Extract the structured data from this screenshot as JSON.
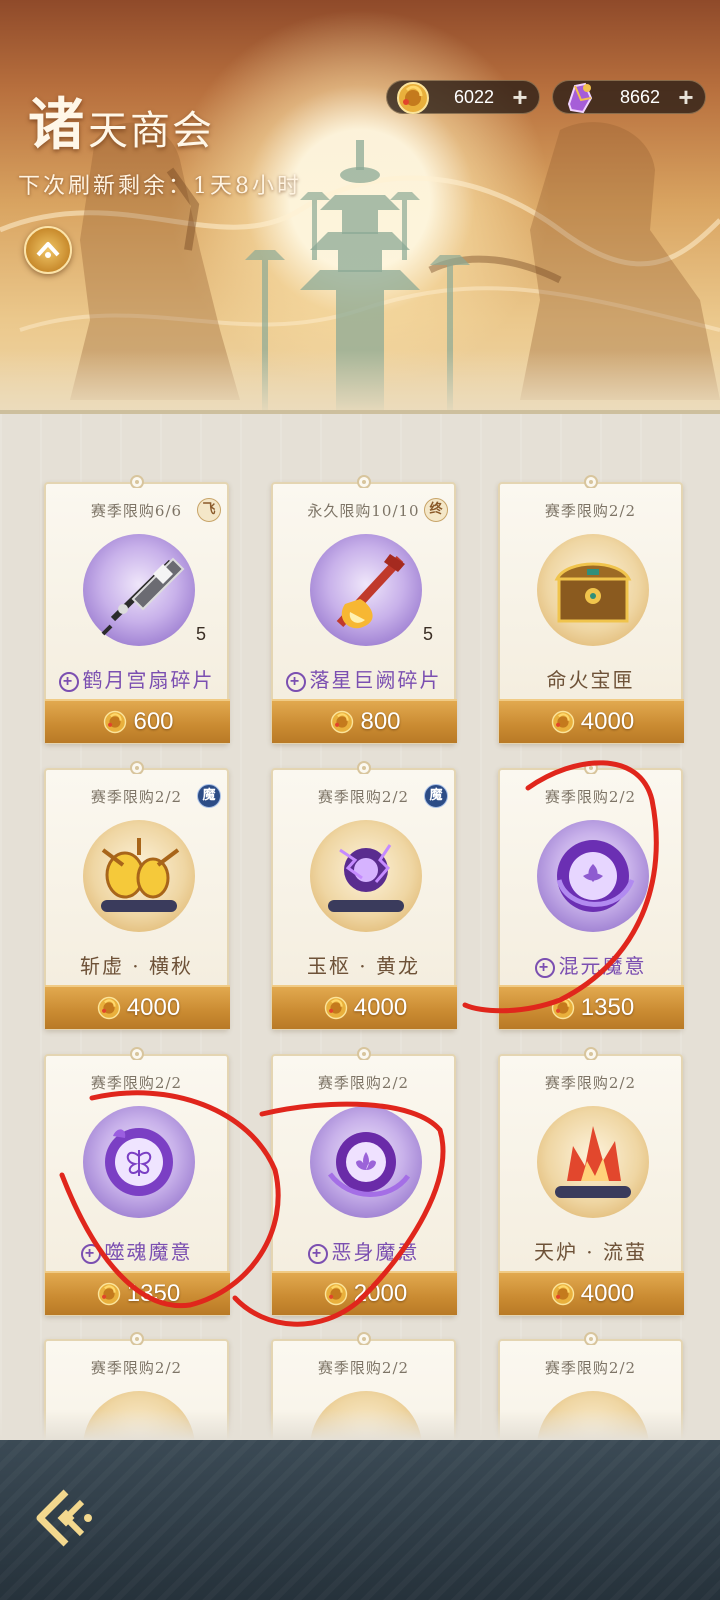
{
  "header": {
    "title_first": "诸",
    "title_rest": "天商会",
    "refresh_text": "下次刷新剩余：1天8小时"
  },
  "currencies": [
    {
      "name": "gold-coin",
      "value": "6022",
      "plus": "+"
    },
    {
      "name": "purple-crystal",
      "value": "8662",
      "plus": "+"
    }
  ],
  "items": [
    {
      "limit": "赛季限购6/6",
      "tag": "飞",
      "tag_style": "brown",
      "name": "鹤月宫扇碎片",
      "count": "5",
      "price": "600",
      "orb": "purple",
      "name_style": "purple",
      "plus": true,
      "icon": "fan-icon"
    },
    {
      "limit": "永久限购10/10",
      "tag": "终",
      "tag_style": "brown",
      "name": "落星巨阙碎片",
      "count": "5",
      "price": "800",
      "orb": "purple",
      "name_style": "purple",
      "plus": true,
      "icon": "sword-icon"
    },
    {
      "limit": "赛季限购2/2",
      "tag": "",
      "tag_style": "",
      "name": "命火宝匣",
      "count": "",
      "price": "4000",
      "orb": "gold",
      "name_style": "brown",
      "plus": false,
      "icon": "treasure-chest-icon"
    },
    {
      "limit": "赛季限购2/2",
      "tag": "魔",
      "tag_style": "blue",
      "name": "斩虚 · 横秋",
      "count": "",
      "price": "4000",
      "orb": "gold",
      "name_style": "brown",
      "plus": false,
      "icon": "golden-orbs-scroll-icon"
    },
    {
      "limit": "赛季限购2/2",
      "tag": "魔",
      "tag_style": "blue",
      "name": "玉枢 · 黄龙",
      "count": "",
      "price": "4000",
      "orb": "gold",
      "name_style": "brown",
      "plus": false,
      "icon": "lightning-scroll-icon"
    },
    {
      "limit": "赛季限购2/2",
      "tag": "",
      "tag_style": "",
      "name": "混元魔意",
      "count": "",
      "price": "1350",
      "orb": "purple",
      "name_style": "purple",
      "plus": true,
      "icon": "purple-flower-orb-icon"
    },
    {
      "limit": "赛季限购2/2",
      "tag": "",
      "tag_style": "",
      "name": "噬魂魔意",
      "count": "",
      "price": "1350",
      "orb": "purple",
      "name_style": "purple",
      "plus": true,
      "icon": "butterfly-orb-icon"
    },
    {
      "limit": "赛季限购2/2",
      "tag": "",
      "tag_style": "",
      "name": "恶身魔意",
      "count": "",
      "price": "2000",
      "orb": "purple",
      "name_style": "purple",
      "plus": true,
      "icon": "lotus-orb-icon"
    },
    {
      "limit": "赛季限购2/2",
      "tag": "",
      "tag_style": "",
      "name": "天炉 · 流萤",
      "count": "",
      "price": "4000",
      "orb": "gold",
      "name_style": "brown",
      "plus": false,
      "icon": "flame-scroll-icon"
    },
    {
      "limit": "赛季限购2/2",
      "tag": "",
      "tag_style": "",
      "name": "",
      "count": "",
      "price": "",
      "orb": "gold",
      "name_style": "brown",
      "plus": false,
      "icon": "red-flame-icon"
    },
    {
      "limit": "赛季限购2/2",
      "tag": "",
      "tag_style": "",
      "name": "",
      "count": "",
      "price": "",
      "orb": "gold",
      "name_style": "brown",
      "plus": false,
      "icon": "gold-flame-icon"
    },
    {
      "limit": "赛季限购2/2",
      "tag": "",
      "tag_style": "",
      "name": "",
      "count": "",
      "price": "",
      "orb": "gold",
      "name_style": "brown",
      "plus": false,
      "icon": "gold-spike-icon"
    }
  ],
  "colors": {
    "annotation_red": "#e0261c",
    "price_gold": "#c98a31",
    "purple_text": "#7b4fb1"
  }
}
